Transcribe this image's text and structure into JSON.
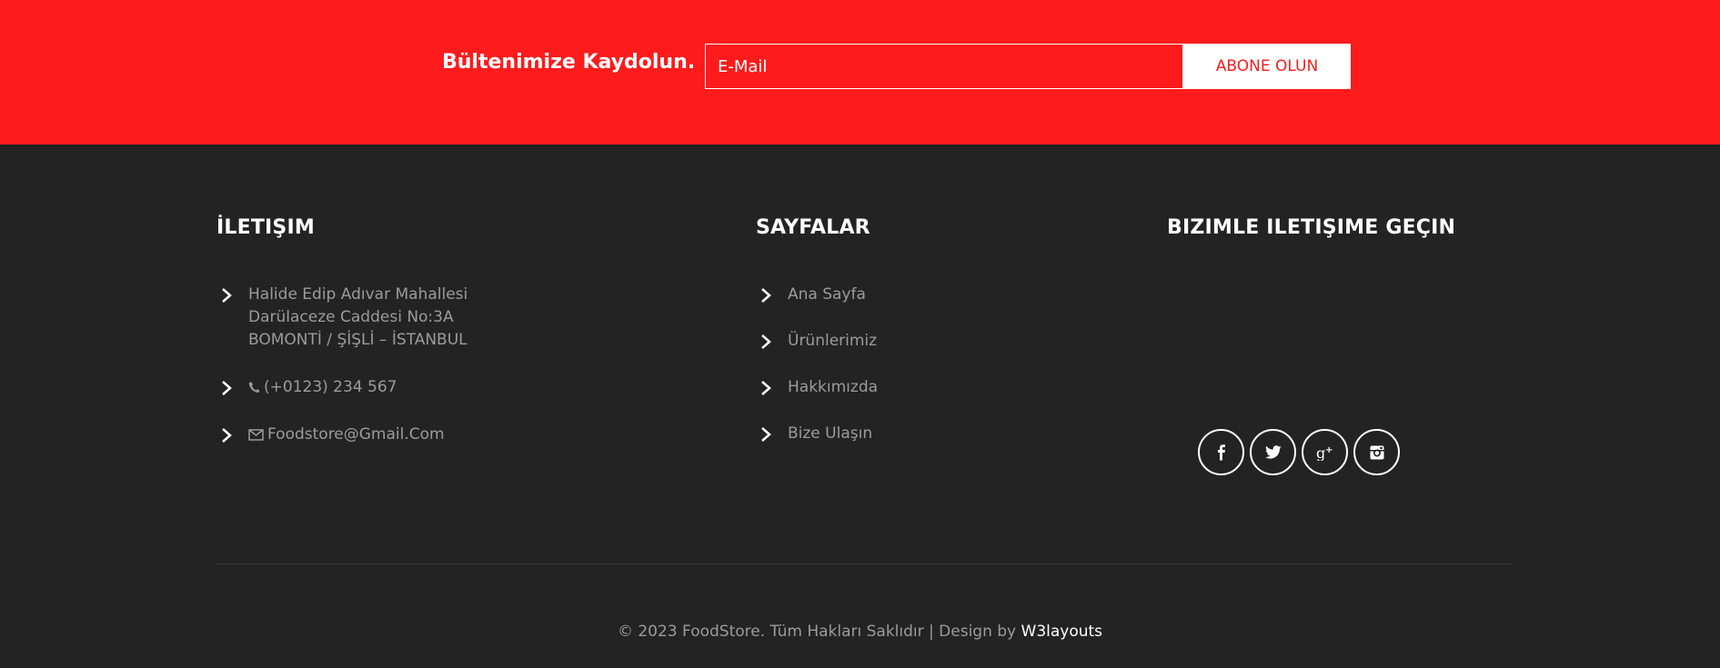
{
  "newsletter": {
    "title": "Bültenimize Kaydolun.",
    "email_placeholder": "E-Mail",
    "subscribe_label": "ABONE OLUN"
  },
  "contact": {
    "title": "İLETIŞIM",
    "address_lines": [
      "Halide Edip Adıvar Mahallesi",
      "Darülaceze Caddesi No:3A",
      "BOMONTİ / ŞİŞLİ – İSTANBUL"
    ],
    "phone": "(+0123) 234 567",
    "email": "Foodstore@Gmail.Com"
  },
  "pages": {
    "title": "SAYFALAR",
    "items": [
      "Ana Sayfa",
      "Ürünlerimiz",
      "Hakkımızda",
      "Bize Ulaşın"
    ]
  },
  "social": {
    "title": "BIZIMLE ILETIŞIME GEÇIN",
    "icons": [
      "facebook-icon",
      "twitter-icon",
      "google-plus-icon",
      "instagram-icon"
    ]
  },
  "copyright": {
    "text": "© 2023 FoodStore. Tüm Hakları Saklıdır | Design by ",
    "link": "W3layouts"
  },
  "colors": {
    "accent": "#fd1b1c",
    "footer_bg": "#232323",
    "muted_text": "#9b9b9b"
  }
}
